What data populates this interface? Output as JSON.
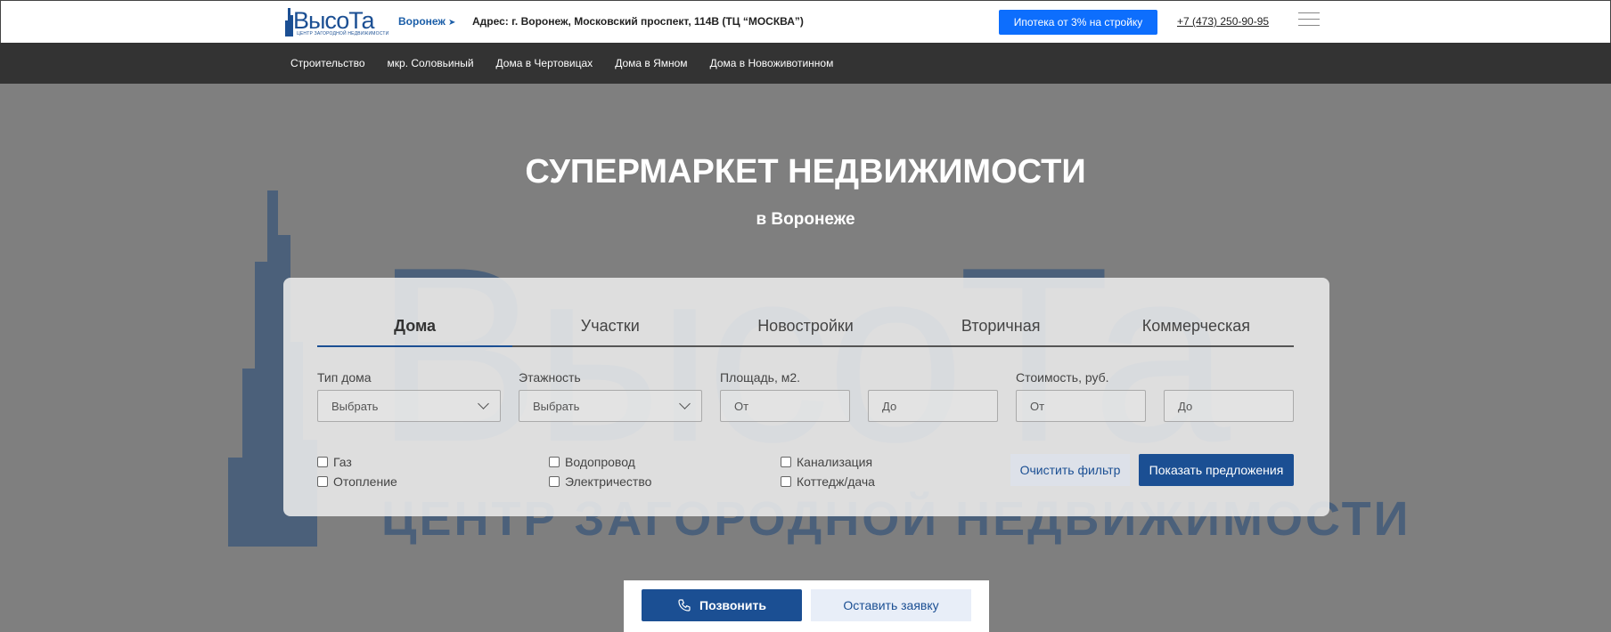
{
  "header": {
    "logo_text": "ВысоТа",
    "logo_subtitle": "ЦЕНТР ЗАГОРОДНОЙ НЕДВИЖИМОСТИ",
    "city": "Воронеж",
    "address": "Адрес: г. Воронеж, Московский проспект, 114В (ТЦ “МОСКВА”)",
    "promo_button": "Ипотека от 3% на стройку",
    "phone": "+7 (473) 250-90-95"
  },
  "nav": {
    "items": [
      {
        "label": "Строительство"
      },
      {
        "label": "мкр. Соловьиный"
      },
      {
        "label": "Дома в Чертовицах"
      },
      {
        "label": "Дома в Ямном"
      },
      {
        "label": "Дома в Новоживотинном"
      }
    ]
  },
  "hero": {
    "title": "СУПЕРМАРКЕТ НЕДВИЖИМОСТИ",
    "subtitle": "в Воронеже",
    "watermark_text": "ВысоТа",
    "watermark_subtitle": "ЦЕНТР ЗАГОРОДНОЙ НЕДВИЖИМОСТИ"
  },
  "filter": {
    "tabs": [
      {
        "label": "Дома",
        "active": true
      },
      {
        "label": "Участки",
        "active": false
      },
      {
        "label": "Новостройки",
        "active": false
      },
      {
        "label": "Вторичная",
        "active": false
      },
      {
        "label": "Коммерческая",
        "active": false
      }
    ],
    "house_type": {
      "label": "Тип дома",
      "value": "Выбрать"
    },
    "floors": {
      "label": "Этажность",
      "value": "Выбрать"
    },
    "area": {
      "label": "Площадь, м2.",
      "from_placeholder": "От",
      "to_placeholder": "До"
    },
    "price": {
      "label": "Стоимость, руб.",
      "from_placeholder": "От",
      "to_placeholder": "До"
    },
    "checkboxes": [
      {
        "label": "Газ",
        "checked": false
      },
      {
        "label": "Отопление",
        "checked": false
      },
      {
        "label": "Водопровод",
        "checked": false
      },
      {
        "label": "Электричество",
        "checked": false
      },
      {
        "label": "Канализация",
        "checked": false
      },
      {
        "label": "Коттедж/дача",
        "checked": false
      }
    ],
    "clear_button": "Очистить фильтр",
    "show_button": "Показать предложения"
  },
  "cta": {
    "call_button": "Позвонить",
    "request_button": "Оставить заявку"
  },
  "colors": {
    "brand_blue": "#1b4f93",
    "promo_blue": "#0d6efd",
    "nav_bg": "#333333"
  }
}
